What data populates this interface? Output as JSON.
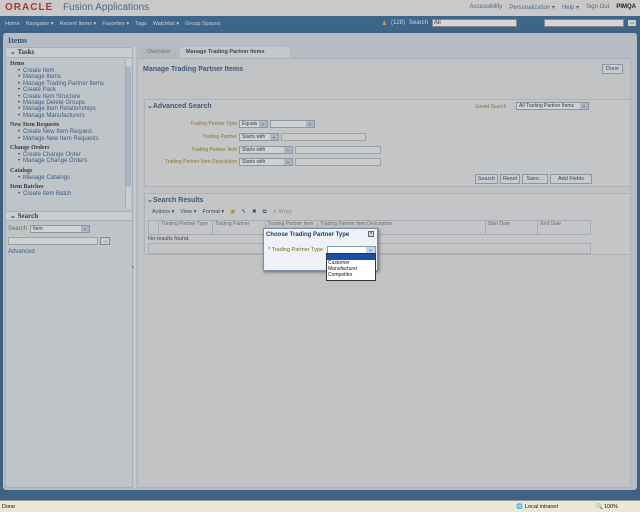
{
  "header": {
    "logo": "ORACLE",
    "app_name": "Fusion Applications",
    "links": [
      "Accessibility",
      "Personalization ▾",
      "Help ▾",
      "Sign Out"
    ],
    "user": "PIMQA"
  },
  "nav": {
    "items": [
      "Home",
      "Navigator ▾",
      "Recent Items ▾",
      "Favorites ▾",
      "Tags",
      "Watchlist ▾",
      "Group Spaces"
    ],
    "notifications": "(128)",
    "search_label": "Search",
    "search_scope": "All"
  },
  "page_title": "Items",
  "tasks": {
    "title": "Tasks",
    "groups": [
      {
        "name": "Items",
        "links": [
          "Create Item",
          "Manage Items",
          "Manage Trading Partner Items",
          "Create Pack",
          "Create Item Structure",
          "Manage Delete Groups",
          "Manage Item Relationships",
          "Manage Manufacturers"
        ]
      },
      {
        "name": "New Item Requests",
        "links": [
          "Create New Item Request",
          "Manage New Item Requests"
        ]
      },
      {
        "name": "Change Orders",
        "links": [
          "Create Change Order",
          "Manage Change Orders"
        ]
      },
      {
        "name": "Catalogs",
        "links": [
          "Manage Catalogs"
        ]
      },
      {
        "name": "Item Batches",
        "links": [
          "Create Item Batch"
        ]
      }
    ]
  },
  "search_panel": {
    "title": "Search",
    "label": "Search",
    "scope": "Item",
    "advanced": "Advanced"
  },
  "tabs": [
    "Overview",
    "Manage Trading Partner Items"
  ],
  "main": {
    "title": "Manage Trading Partner Items",
    "done": "Done",
    "advanced_search": {
      "title": "Advanced Search",
      "saved_search_label": "Saved Search",
      "saved_search": "All Trading Partner Items",
      "fields": [
        {
          "label": "Trading Partner Type",
          "operator": "Equals"
        },
        {
          "label": "Trading Partner",
          "operator": "Starts with"
        },
        {
          "label": "Trading Partner Item",
          "operator": "Starts with"
        },
        {
          "label": "Trading Partner Item Description",
          "operator": "Starts with"
        }
      ],
      "buttons": [
        "Search",
        "Reset",
        "Save...",
        "Add Fields"
      ]
    },
    "results": {
      "title": "Search Results",
      "menus": [
        "Actions ▾",
        "View ▾",
        "Format ▾"
      ],
      "wrap": "Wrap",
      "columns": [
        "Trading Partner Type",
        "Trading Partner",
        "Trading Partner Item",
        "Trading Partner Item Description",
        "Start Date",
        "End Date"
      ],
      "empty": "No results found."
    }
  },
  "dialog": {
    "title": "Choose Trading Partner Type",
    "label": "* Trading Partner Type",
    "options": [
      "",
      "Customer",
      "Manufacturer",
      "Competitor"
    ]
  },
  "statusbar": {
    "text": "Done",
    "zone": "Local intranet",
    "zoom": "100%"
  }
}
